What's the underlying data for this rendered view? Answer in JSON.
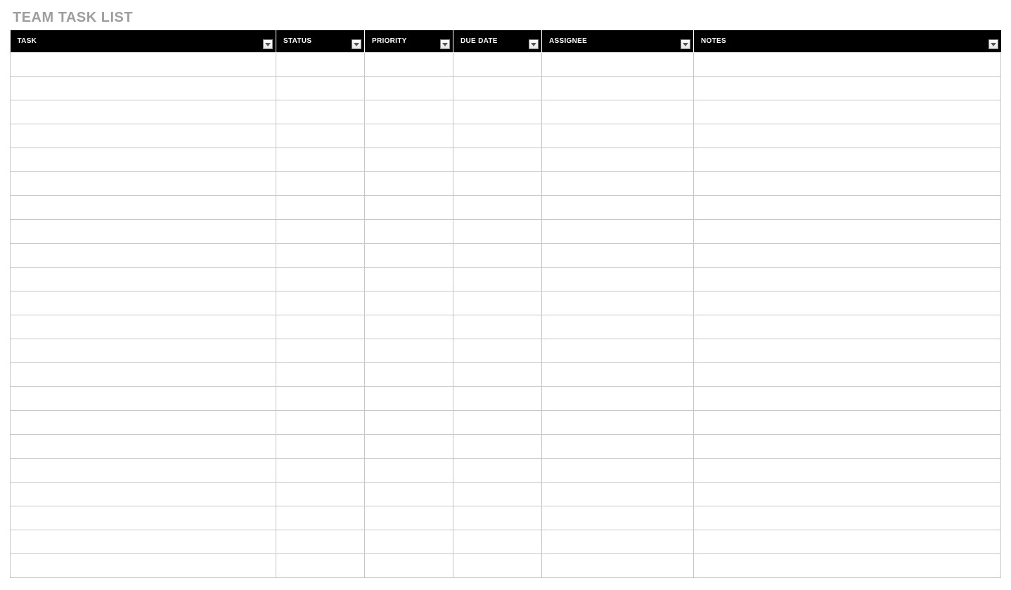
{
  "title": "TEAM TASK LIST",
  "columns": [
    {
      "label": "TASK",
      "key": "task",
      "filter": true
    },
    {
      "label": "STATUS",
      "key": "status",
      "filter": true
    },
    {
      "label": "PRIORITY",
      "key": "priority",
      "filter": true
    },
    {
      "label": "DUE DATE",
      "key": "due_date",
      "filter": true
    },
    {
      "label": "ASSIGNEE",
      "key": "assignee",
      "filter": true
    },
    {
      "label": "NOTES",
      "key": "notes",
      "filter": true
    }
  ],
  "rows": [
    {
      "task": "",
      "status": "",
      "priority": "",
      "due_date": "",
      "assignee": "",
      "notes": ""
    },
    {
      "task": "",
      "status": "",
      "priority": "",
      "due_date": "",
      "assignee": "",
      "notes": ""
    },
    {
      "task": "",
      "status": "",
      "priority": "",
      "due_date": "",
      "assignee": "",
      "notes": ""
    },
    {
      "task": "",
      "status": "",
      "priority": "",
      "due_date": "",
      "assignee": "",
      "notes": ""
    },
    {
      "task": "",
      "status": "",
      "priority": "",
      "due_date": "",
      "assignee": "",
      "notes": ""
    },
    {
      "task": "",
      "status": "",
      "priority": "",
      "due_date": "",
      "assignee": "",
      "notes": ""
    },
    {
      "task": "",
      "status": "",
      "priority": "",
      "due_date": "",
      "assignee": "",
      "notes": ""
    },
    {
      "task": "",
      "status": "",
      "priority": "",
      "due_date": "",
      "assignee": "",
      "notes": ""
    },
    {
      "task": "",
      "status": "",
      "priority": "",
      "due_date": "",
      "assignee": "",
      "notes": ""
    },
    {
      "task": "",
      "status": "",
      "priority": "",
      "due_date": "",
      "assignee": "",
      "notes": ""
    },
    {
      "task": "",
      "status": "",
      "priority": "",
      "due_date": "",
      "assignee": "",
      "notes": ""
    },
    {
      "task": "",
      "status": "",
      "priority": "",
      "due_date": "",
      "assignee": "",
      "notes": ""
    },
    {
      "task": "",
      "status": "",
      "priority": "",
      "due_date": "",
      "assignee": "",
      "notes": ""
    },
    {
      "task": "",
      "status": "",
      "priority": "",
      "due_date": "",
      "assignee": "",
      "notes": ""
    },
    {
      "task": "",
      "status": "",
      "priority": "",
      "due_date": "",
      "assignee": "",
      "notes": ""
    },
    {
      "task": "",
      "status": "",
      "priority": "",
      "due_date": "",
      "assignee": "",
      "notes": ""
    },
    {
      "task": "",
      "status": "",
      "priority": "",
      "due_date": "",
      "assignee": "",
      "notes": ""
    },
    {
      "task": "",
      "status": "",
      "priority": "",
      "due_date": "",
      "assignee": "",
      "notes": ""
    },
    {
      "task": "",
      "status": "",
      "priority": "",
      "due_date": "",
      "assignee": "",
      "notes": ""
    },
    {
      "task": "",
      "status": "",
      "priority": "",
      "due_date": "",
      "assignee": "",
      "notes": ""
    },
    {
      "task": "",
      "status": "",
      "priority": "",
      "due_date": "",
      "assignee": "",
      "notes": ""
    },
    {
      "task": "",
      "status": "",
      "priority": "",
      "due_date": "",
      "assignee": "",
      "notes": ""
    }
  ]
}
